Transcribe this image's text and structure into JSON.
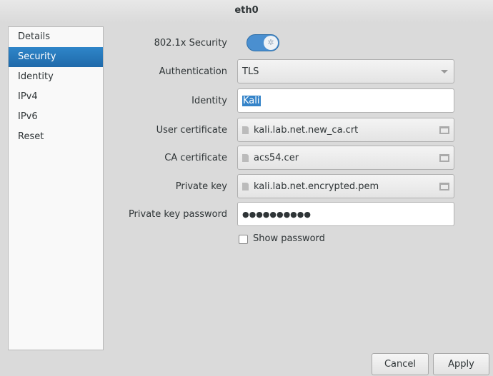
{
  "window": {
    "title": "eth0"
  },
  "sidebar": {
    "items": [
      {
        "label": "Details"
      },
      {
        "label": "Security",
        "active": true
      },
      {
        "label": "Identity"
      },
      {
        "label": "IPv4"
      },
      {
        "label": "IPv6"
      },
      {
        "label": "Reset"
      }
    ]
  },
  "form": {
    "security_label": "802.1x Security",
    "security_enabled": true,
    "auth_label": "Authentication",
    "auth_value": "TLS",
    "identity_label": "Identity",
    "identity_value": "Kali",
    "user_cert_label": "User certificate",
    "user_cert_value": "kali.lab.net.new_ca.crt",
    "ca_cert_label": "CA certificate",
    "ca_cert_value": "acs54.cer",
    "private_key_label": "Private key",
    "private_key_value": "kali.lab.net.encrypted.pem",
    "pk_password_label": "Private key password",
    "pk_password_value": "●●●●●●●●●●",
    "show_password_label": "Show password",
    "show_password_checked": false
  },
  "buttons": {
    "cancel": "Cancel",
    "apply": "Apply"
  }
}
